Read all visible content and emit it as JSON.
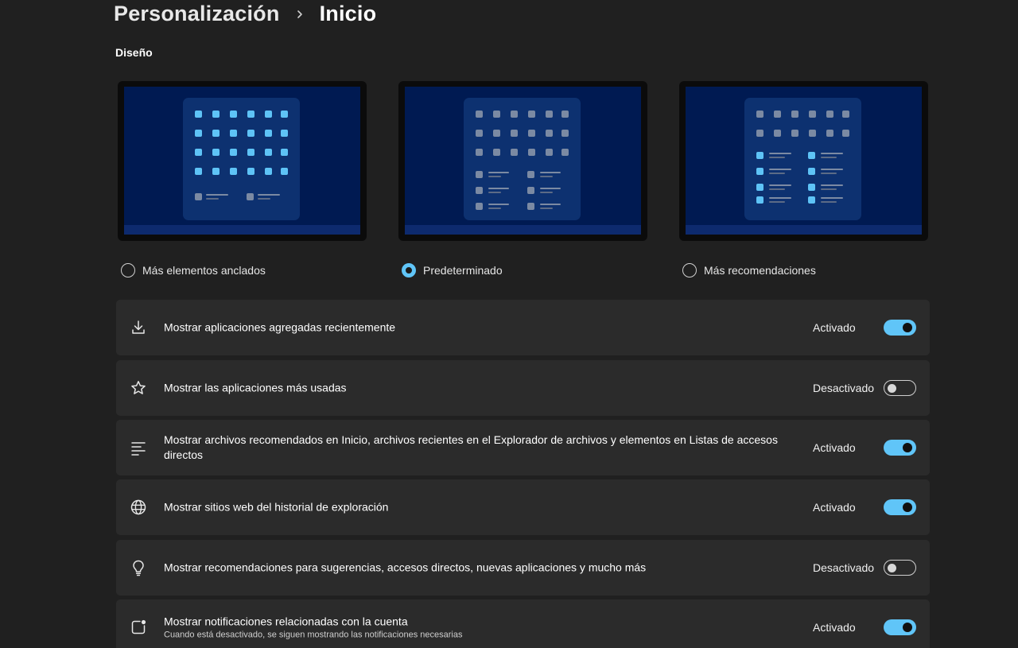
{
  "breadcrumb": {
    "parent": "Personalización",
    "current": "Inicio"
  },
  "section": {
    "label": "Diseño"
  },
  "layouts": [
    {
      "label": "Más elementos anclados",
      "selected": false
    },
    {
      "label": "Predeterminado",
      "selected": true
    },
    {
      "label": "Más recomendaciones",
      "selected": false
    }
  ],
  "settings": [
    {
      "icon": "download-icon",
      "label": "Mostrar aplicaciones agregadas recientemente",
      "sub": "",
      "state": "Activado",
      "on": true
    },
    {
      "icon": "star-icon",
      "label": "Mostrar las aplicaciones más usadas",
      "sub": "",
      "state": "Desactivado",
      "on": false
    },
    {
      "icon": "list-icon",
      "label": "Mostrar archivos recomendados en Inicio, archivos recientes en el Explorador de archivos y elementos en Listas de accesos directos",
      "sub": "",
      "state": "Activado",
      "on": true
    },
    {
      "icon": "globe-icon",
      "label": "Mostrar sitios web del historial de exploración",
      "sub": "",
      "state": "Activado",
      "on": true
    },
    {
      "icon": "lightbulb-icon",
      "label": "Mostrar recomendaciones para sugerencias, accesos directos, nuevas aplicaciones y mucho más",
      "sub": "",
      "state": "Desactivado",
      "on": false
    },
    {
      "icon": "notification-icon",
      "label": "Mostrar notificaciones relacionadas con la cuenta",
      "sub": "Cuando está desactivado, se siguen mostrando las notificaciones necesarias",
      "state": "Activado",
      "on": true
    }
  ],
  "colors": {
    "accent": "#60c5f8",
    "background": "#202020",
    "card": "#2b2b2b"
  }
}
